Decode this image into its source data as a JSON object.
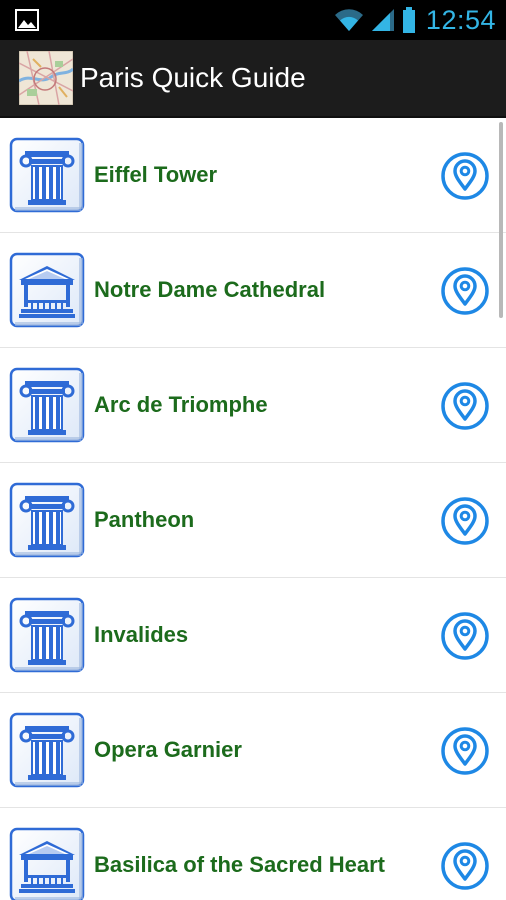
{
  "status_bar": {
    "time": "12:54",
    "icons": [
      "gallery-icon",
      "wifi-icon",
      "signal-icon",
      "battery-icon"
    ]
  },
  "action_bar": {
    "title": "Paris Quick Guide",
    "app_icon": "paris-map-icon"
  },
  "colors": {
    "label_green": "#1c6b1c",
    "accent_blue": "#1e88e5",
    "status_clock": "#33b5e5",
    "action_bar_bg": "#1c1c1c"
  },
  "list": {
    "items": [
      {
        "label": "Eiffel Tower",
        "icon": "column-icon"
      },
      {
        "label": "Notre Dame Cathedral",
        "icon": "pavilion-icon"
      },
      {
        "label": "Arc de Triomphe",
        "icon": "column-icon"
      },
      {
        "label": "Pantheon",
        "icon": "column-icon"
      },
      {
        "label": "Invalides",
        "icon": "column-icon"
      },
      {
        "label": "Opera Garnier",
        "icon": "column-icon"
      },
      {
        "label": "Basilica of the Sacred Heart",
        "icon": "pavilion-icon"
      }
    ]
  }
}
